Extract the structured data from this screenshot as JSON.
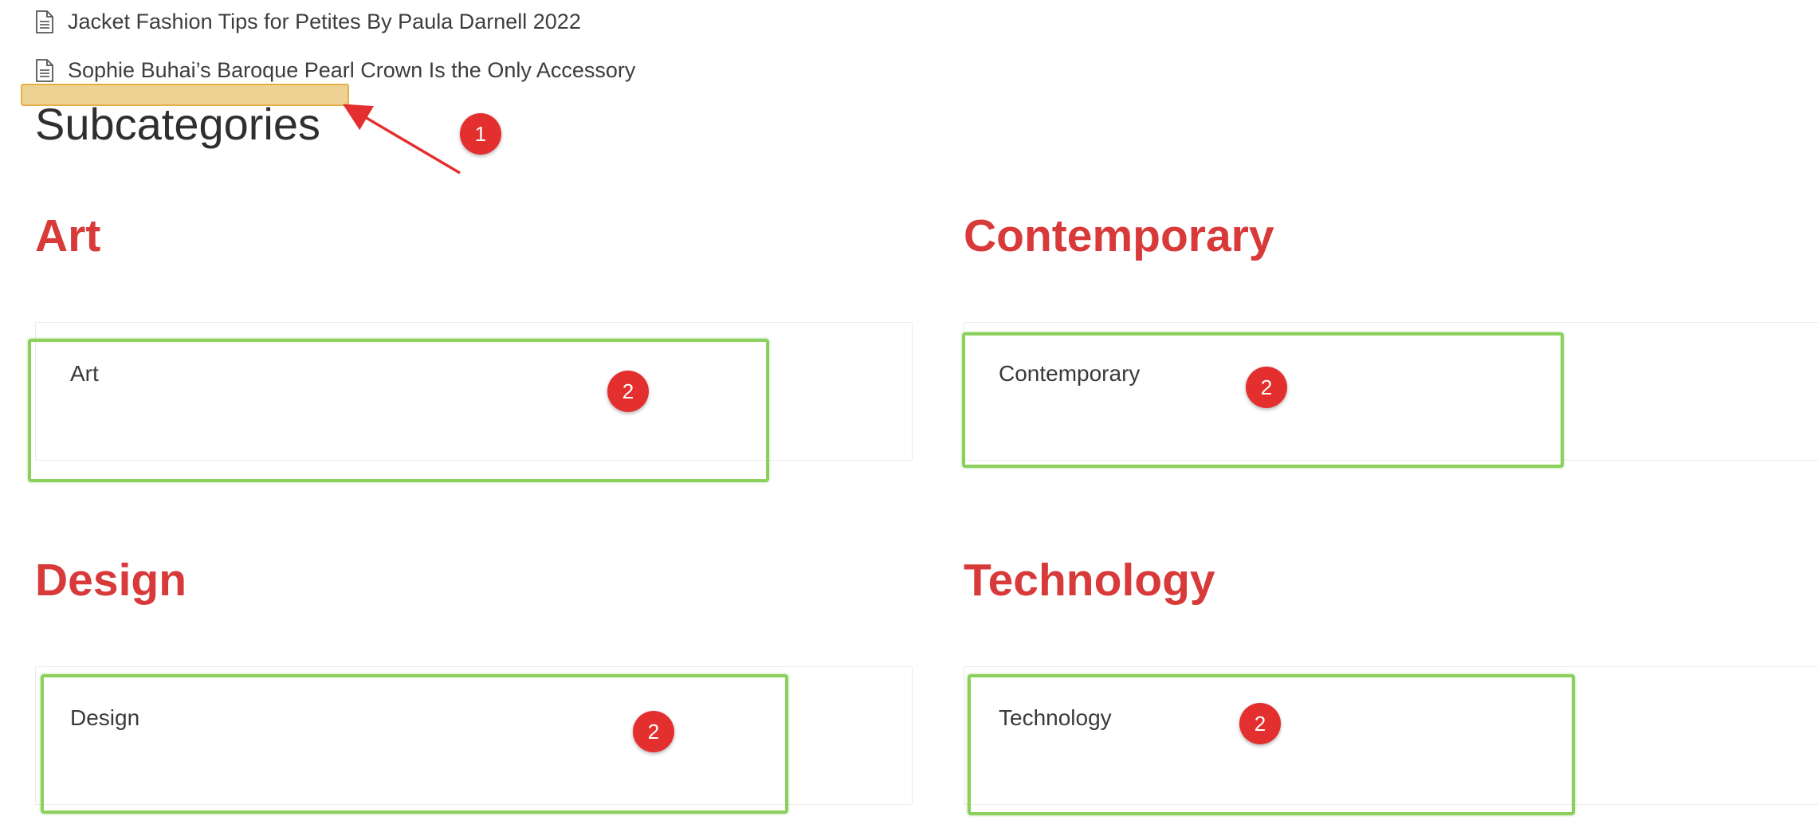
{
  "articles": [
    {
      "title": "Jacket Fashion Tips for Petites By Paula Darnell 2022",
      "icon": "document-icon"
    },
    {
      "title": "Sophie Buhai’s Baroque Pearl Crown Is the Only Accessory",
      "icon": "document-icon"
    }
  ],
  "section": {
    "title": "Subcategories"
  },
  "subcategories": [
    {
      "heading": "Art",
      "card_label": "Art"
    },
    {
      "heading": "Contemporary",
      "card_label": "Contemporary"
    },
    {
      "heading": "Design",
      "card_label": "Design"
    },
    {
      "heading": "Technology",
      "card_label": "Technology"
    }
  ],
  "annotations": {
    "badges": [
      "1",
      "2",
      "2",
      "2",
      "2"
    ],
    "colors": {
      "badge": "#e3302f",
      "arrow": "#e3302f",
      "highlight": "#e4b750",
      "outline": "#8bd05c"
    }
  },
  "colors": {
    "heading_accent": "#d83a3a",
    "text": "#3d3d3d"
  }
}
